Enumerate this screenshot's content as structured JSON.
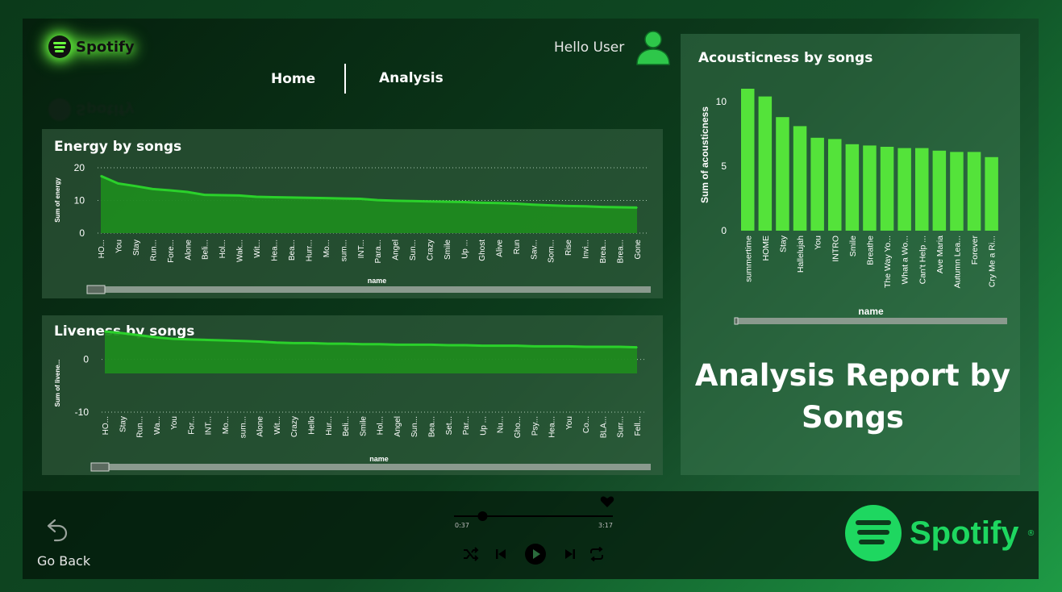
{
  "header": {
    "logo_text": "Spotify",
    "greeting": "Hello User",
    "nav": [
      {
        "label": "Home"
      },
      {
        "label": "Analysis"
      }
    ]
  },
  "energy_chart": {
    "title": "Energy by songs",
    "ylabel": "Sum of energy",
    "xlabel": "name",
    "yticks": [
      "20",
      "10",
      "0"
    ]
  },
  "liveness_chart": {
    "title": "Liveness by songs",
    "ylabel": "Sum of livene...",
    "xlabel": "name",
    "yticks": [
      "0",
      "-10"
    ]
  },
  "acousticness_chart": {
    "title": "Acousticness by songs",
    "ylabel": "Sum of acousticness",
    "xlabel": "name",
    "yticks": [
      "10",
      "5",
      "0"
    ]
  },
  "report_title": "Analysis Report by Songs",
  "player": {
    "go_back_label": "Go Back",
    "time_elapsed": "0:37",
    "time_total": "3:17",
    "progress": 0.18,
    "logo_text": "Spotify"
  },
  "colors": {
    "accent": "#1ed760",
    "bar": "#54e33a",
    "area": "#1f8a1f",
    "line": "#2bd12b"
  },
  "chart_data": [
    {
      "type": "area",
      "title": "Energy by songs",
      "xlabel": "name",
      "ylabel": "Sum of energy",
      "ylim": [
        0,
        20
      ],
      "categories": [
        "HO...",
        "You",
        "Stay",
        "Run...",
        "Fore...",
        "Alone",
        "Beli...",
        "Hol...",
        "Wak...",
        "Wit...",
        "Hea...",
        "Bea...",
        "Hurr...",
        "Mo...",
        "sum...",
        "INT...",
        "Para...",
        "Angel",
        "Sun...",
        "Crazy",
        "Smile",
        "Up ...",
        "Ghost",
        "Alive",
        "Run",
        "Sav...",
        "Som...",
        "Rise",
        "Invi...",
        "Brea...",
        "Brea...",
        "Gone"
      ],
      "values": [
        17.5,
        15.2,
        14.4,
        13.5,
        13.1,
        12.6,
        11.7,
        11.6,
        11.5,
        11.1,
        11.0,
        10.9,
        10.8,
        10.7,
        10.6,
        10.5,
        10.1,
        9.9,
        9.8,
        9.7,
        9.6,
        9.5,
        9.3,
        9.2,
        9.0,
        8.7,
        8.5,
        8.3,
        8.2,
        8.0,
        7.9,
        7.8
      ]
    },
    {
      "type": "area",
      "title": "Liveness by songs",
      "xlabel": "name",
      "ylabel": "Sum of livene...",
      "ylim": [
        -10,
        5
      ],
      "categories": [
        "HO...",
        "Stay",
        "Run...",
        "Wa...",
        "You",
        "For...",
        "INT...",
        "Mo...",
        "sum...",
        "Alone",
        "Wit...",
        "Crazy",
        "Hello",
        "Hur...",
        "Beli...",
        "Smile",
        "Hol...",
        "Angel",
        "Sun...",
        "Bea...",
        "Set...",
        "Par...",
        "Up ...",
        "Nu...",
        "Gho...",
        "Psy...",
        "Hea...",
        "You",
        "Co...",
        "BLA...",
        "Surr...",
        "Fell..."
      ],
      "values": [
        5.3,
        5.0,
        4.6,
        4.2,
        3.9,
        3.8,
        3.7,
        3.6,
        3.5,
        3.4,
        3.2,
        3.1,
        3.1,
        3.0,
        3.0,
        2.9,
        2.9,
        2.8,
        2.8,
        2.8,
        2.7,
        2.7,
        2.6,
        2.6,
        2.6,
        2.5,
        2.5,
        2.5,
        2.4,
        2.4,
        2.4,
        2.3
      ]
    },
    {
      "type": "bar",
      "title": "Acousticness by songs",
      "xlabel": "name",
      "ylabel": "Sum of acousticness",
      "ylim": [
        0,
        11.5
      ],
      "categories": [
        "summertime",
        "HOME",
        "Stay",
        "Hallelujah",
        "You",
        "INTRO",
        "Smile",
        "Breathe",
        "The Way Yo...",
        "What a Wo...",
        "Can't Help ...",
        "Ave Maria",
        "Autumn Lea...",
        "Forever",
        "Cry Me a Ri..."
      ],
      "values": [
        11.0,
        10.4,
        8.8,
        8.1,
        7.2,
        7.1,
        6.7,
        6.6,
        6.5,
        6.4,
        6.4,
        6.2,
        6.1,
        6.1,
        5.7
      ]
    }
  ]
}
